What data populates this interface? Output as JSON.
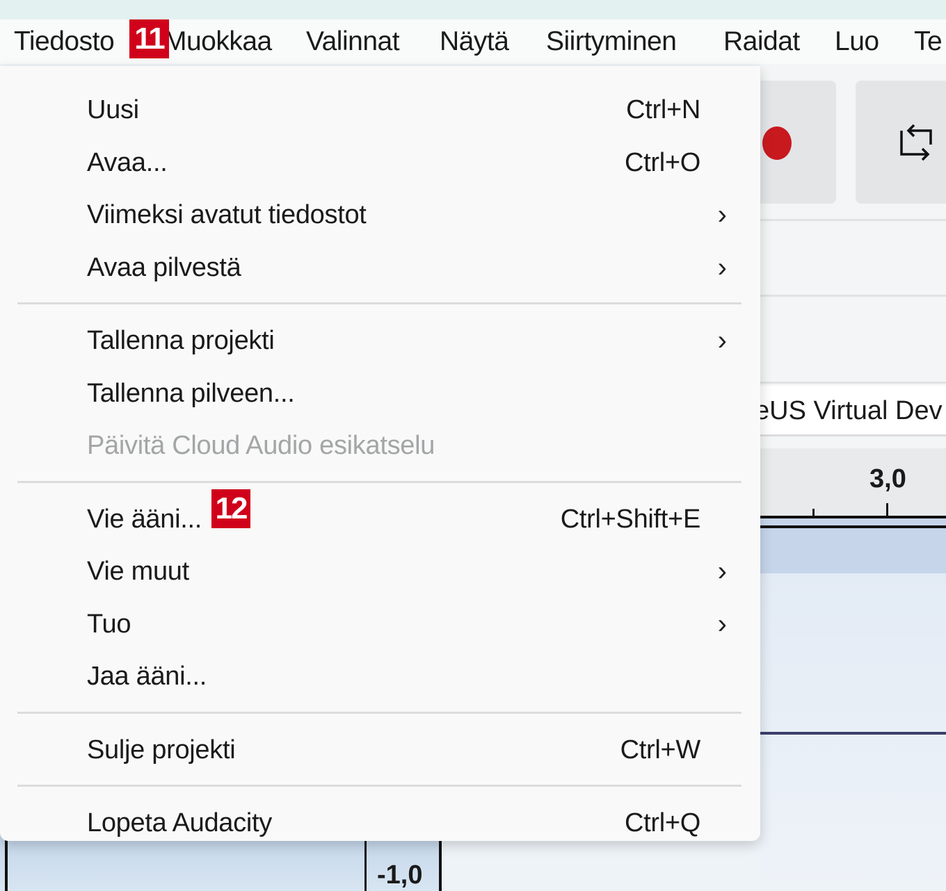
{
  "menubar": {
    "items": [
      "Tiedosto",
      "Muokkaa",
      "Valinnat",
      "Näytä",
      "Siirtyminen",
      "Raidat",
      "Luo",
      "Te"
    ]
  },
  "badges": {
    "first": "11",
    "second": "12"
  },
  "menu": {
    "groups": [
      [
        {
          "label": "Uusi",
          "shortcut": "Ctrl+N"
        },
        {
          "label": "Avaa...",
          "shortcut": "Ctrl+O"
        },
        {
          "label": "Viimeksi avatut tiedostot",
          "submenu": true
        },
        {
          "label": "Avaa pilvestä",
          "submenu": true
        }
      ],
      [
        {
          "label": "Tallenna projekti",
          "submenu": true
        },
        {
          "label": "Tallenna pilveen..."
        },
        {
          "label": "Päivitä Cloud Audio esikatselu",
          "disabled": true
        }
      ],
      [
        {
          "label": "Vie ääni...",
          "shortcut": "Ctrl+Shift+E"
        },
        {
          "label": "Vie muut",
          "submenu": true
        },
        {
          "label": "Tuo",
          "submenu": true
        },
        {
          "label": "Jaa ääni..."
        }
      ],
      [
        {
          "label": "Sulje projekti",
          "shortcut": "Ctrl+W"
        }
      ],
      [
        {
          "label": "Lopeta Audacity",
          "shortcut": "Ctrl+Q"
        }
      ]
    ]
  },
  "background": {
    "device_text": "eUS Virtual Dev",
    "ruler_label": "3,0",
    "scale_label": "-1,0"
  },
  "colors": {
    "badge": "#d0021b",
    "record": "#c8191f"
  }
}
